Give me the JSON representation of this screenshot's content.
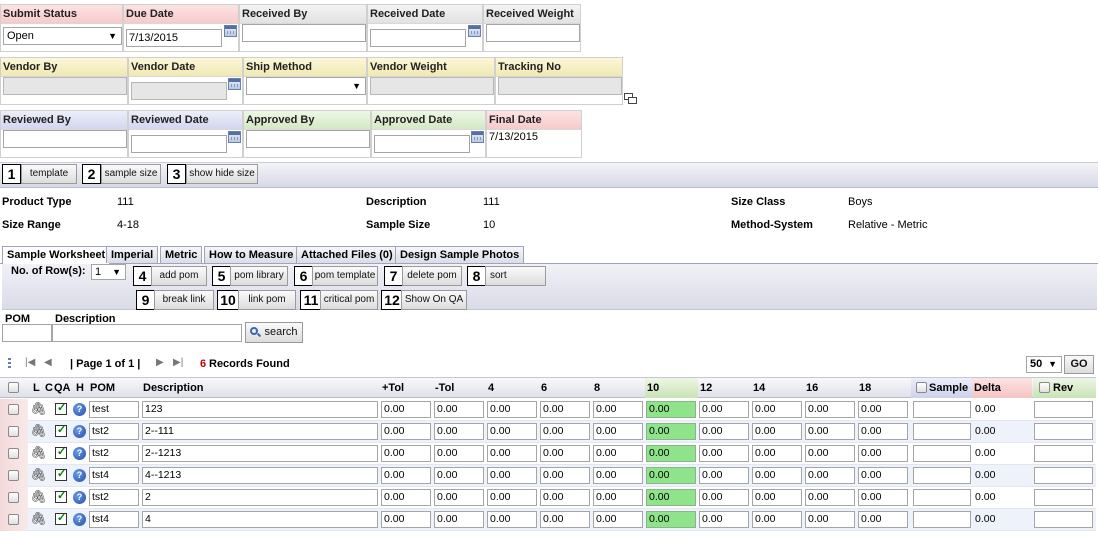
{
  "header_fields": {
    "submit_status": {
      "label": "Submit Status",
      "value": "Open"
    },
    "due_date": {
      "label": "Due Date",
      "value": "7/13/2015"
    },
    "received_by": {
      "label": "Received By",
      "value": ""
    },
    "received_date": {
      "label": "Received Date",
      "value": ""
    },
    "received_weight": {
      "label": "Received Weight",
      "value": ""
    },
    "vendor_by": {
      "label": "Vendor By",
      "value": ""
    },
    "vendor_date": {
      "label": "Vendor Date",
      "value": ""
    },
    "ship_method": {
      "label": "Ship Method",
      "value": ""
    },
    "vendor_weight": {
      "label": "Vendor Weight",
      "value": ""
    },
    "tracking_no": {
      "label": "Tracking No",
      "value": ""
    },
    "reviewed_by": {
      "label": "Reviewed By",
      "value": ""
    },
    "reviewed_date": {
      "label": "Reviewed Date",
      "value": ""
    },
    "approved_by": {
      "label": "Approved By",
      "value": ""
    },
    "approved_date": {
      "label": "Approved Date",
      "value": ""
    },
    "final_date": {
      "label": "Final Date",
      "value": "7/13/2015"
    }
  },
  "top_actions": [
    {
      "num": "1",
      "label": "template"
    },
    {
      "num": "2",
      "label": "sample size"
    },
    {
      "num": "3",
      "label": "show hide size"
    }
  ],
  "info": {
    "product_type": {
      "label": "Product Type",
      "value": "111"
    },
    "description": {
      "label": "Description",
      "value": "111"
    },
    "size_class": {
      "label": "Size Class",
      "value": "Boys"
    },
    "size_range": {
      "label": "Size Range",
      "value": "4-18"
    },
    "sample_size": {
      "label": "Sample Size",
      "value": "10"
    },
    "method_system": {
      "label": "Method-System",
      "value": "Relative - Metric"
    }
  },
  "tabs": [
    "Sample Worksheet",
    "Imperial",
    "Metric",
    "How to Measure",
    "Attached Files (0)",
    "Design Sample Photos"
  ],
  "rows_control": {
    "label": "No. of Row(s):",
    "value": "1"
  },
  "grid_actions": [
    {
      "num": "4",
      "label": "add pom"
    },
    {
      "num": "5",
      "label": "pom library"
    },
    {
      "num": "6",
      "label": "pom template"
    },
    {
      "num": "7",
      "label": "delete pom"
    },
    {
      "num": "8",
      "label": "sort"
    },
    {
      "num": "9",
      "label": "break link"
    },
    {
      "num": "10",
      "label": "link pom"
    },
    {
      "num": "11",
      "label": "critical pom"
    },
    {
      "num": "12",
      "label": "Show On QA"
    }
  ],
  "search": {
    "pom_label": "POM",
    "desc_label": "Description",
    "button": "search"
  },
  "pager": {
    "page_text": "| Page 1 of 1 |",
    "records_count": "6",
    "records_label": "Records Found",
    "page_size": "50",
    "go": "GO"
  },
  "grid_columns": [
    "L",
    "C",
    "QA",
    "H",
    "POM",
    "Description",
    "+Tol",
    "-Tol",
    "4",
    "6",
    "8",
    "10",
    "12",
    "14",
    "16",
    "18",
    "Sample",
    "Delta",
    "Rev"
  ],
  "grid_rows": [
    {
      "pom": "test",
      "description": "123",
      "values": [
        "0.00",
        "0.00",
        "0.00",
        "0.00",
        "0.00",
        "0.00",
        "0.00",
        "0.00",
        "0.00",
        "0.00"
      ],
      "delta": "0.00"
    },
    {
      "pom": "tst2",
      "description": "2--111",
      "values": [
        "0.00",
        "0.00",
        "0.00",
        "0.00",
        "0.00",
        "0.00",
        "0.00",
        "0.00",
        "0.00",
        "0.00"
      ],
      "delta": "0.00"
    },
    {
      "pom": "tst2",
      "description": "2--1213",
      "values": [
        "0.00",
        "0.00",
        "0.00",
        "0.00",
        "0.00",
        "0.00",
        "0.00",
        "0.00",
        "0.00",
        "0.00"
      ],
      "delta": "0.00"
    },
    {
      "pom": "tst4",
      "description": "4--1213",
      "values": [
        "0.00",
        "0.00",
        "0.00",
        "0.00",
        "0.00",
        "0.00",
        "0.00",
        "0.00",
        "0.00",
        "0.00"
      ],
      "delta": "0.00"
    },
    {
      "pom": "tst2",
      "description": "2",
      "values": [
        "0.00",
        "0.00",
        "0.00",
        "0.00",
        "0.00",
        "0.00",
        "0.00",
        "0.00",
        "0.00",
        "0.00"
      ],
      "delta": "0.00"
    },
    {
      "pom": "tst4",
      "description": "4",
      "values": [
        "0.00",
        "0.00",
        "0.00",
        "0.00",
        "0.00",
        "0.00",
        "0.00",
        "0.00",
        "0.00",
        "0.00"
      ],
      "delta": "0.00"
    }
  ],
  "colors": {
    "sample_size_highlight": "#8fe38a",
    "records_count": "#c00000"
  },
  "icons": [
    "calendar-icon",
    "copy-icon",
    "paperclip-icon",
    "help-icon",
    "search-icon",
    "first-page-icon",
    "prev-page-icon",
    "next-page-icon",
    "last-page-icon"
  ]
}
